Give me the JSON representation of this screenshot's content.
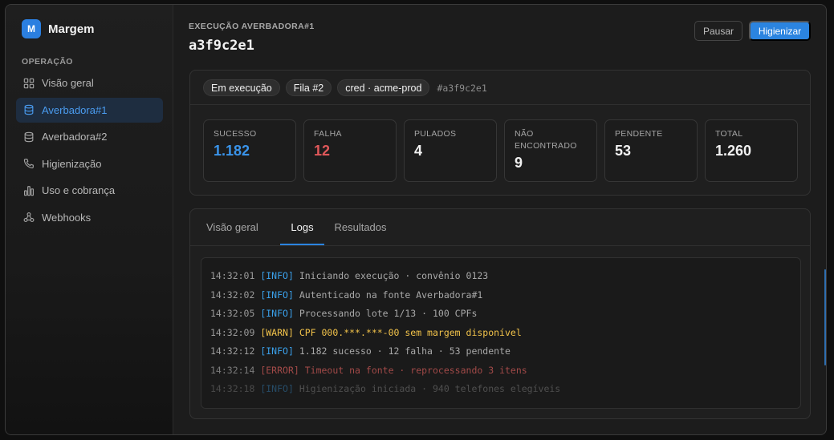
{
  "sidebar": {
    "brand_initial": "M",
    "brand_name": "Margem",
    "section_label": "OPERAÇÃO",
    "items": [
      {
        "label": "Visão geral",
        "icon": "grid-icon",
        "active": false
      },
      {
        "label": "Averbadora#1",
        "icon": "database-icon",
        "active": true
      },
      {
        "label": "Averbadora#2",
        "icon": "database-icon",
        "active": false
      },
      {
        "label": "Higienização",
        "icon": "phone-icon",
        "active": false
      },
      {
        "label": "Uso e cobrança",
        "icon": "bar-chart-icon",
        "active": false
      },
      {
        "label": "Webhooks",
        "icon": "webhook-icon",
        "active": false
      }
    ]
  },
  "header": {
    "eyebrow": "EXECUÇÃO AVERBADORA#1",
    "run_id": "a3f9c2e1",
    "pause_label": "Pausar",
    "clean_label": "Higienizar"
  },
  "status": {
    "pills": [
      "Em execução",
      "Fila #2",
      "cred · acme-prod"
    ],
    "hash": "#a3f9c2e1",
    "metrics": [
      {
        "label": "SUCESSO",
        "value": "1.182",
        "color": "#3a94ea"
      },
      {
        "label": "FALHA",
        "value": "12",
        "color": "#e0585a"
      },
      {
        "label": "PULADOS",
        "value": "4",
        "color": "#f0f0f0"
      },
      {
        "label": "NÃO ENCONTRADO",
        "value": "9",
        "color": "#f0f0f0"
      },
      {
        "label": "PENDENTE",
        "value": "53",
        "color": "#f0f0f0"
      },
      {
        "label": "TOTAL",
        "value": "1.260",
        "color": "#f0f0f0"
      }
    ]
  },
  "tabs": [
    {
      "label": "Visão geral",
      "active": false
    },
    {
      "label": "Logs",
      "active": true
    },
    {
      "label": "Resultados",
      "active": false
    }
  ],
  "logs": [
    {
      "time": "14:32:01",
      "level": "[INFO]",
      "kind": "info",
      "message": "Iniciando execução · convênio 0123"
    },
    {
      "time": "14:32:02",
      "level": "[INFO]",
      "kind": "info",
      "message": "Autenticado na fonte Averbadora#1"
    },
    {
      "time": "14:32:05",
      "level": "[INFO]",
      "kind": "info",
      "message": "Processando lote 1/13 · 100 CPFs"
    },
    {
      "time": "14:32:09",
      "level": "[WARN]",
      "kind": "warn",
      "message": "CPF 000.***.***-00 sem margem disponível"
    },
    {
      "time": "14:32:12",
      "level": "[INFO]",
      "kind": "info",
      "message": "1.182 sucesso · 12 falha · 53 pendente"
    },
    {
      "time": "14:32:14",
      "level": "[ERROR]",
      "kind": "error",
      "message": "Timeout na fonte · reprocessando 3 itens"
    },
    {
      "time": "14:32:18",
      "level": "[INFO]",
      "kind": "info",
      "message": "Higienização iniciada · 940 telefones elegíveis"
    }
  ],
  "colors": {
    "accent": "#2b84e0",
    "success": "#3a94ea",
    "failure": "#e0585a",
    "warn": "#f1c24a",
    "error": "#d05a58"
  }
}
